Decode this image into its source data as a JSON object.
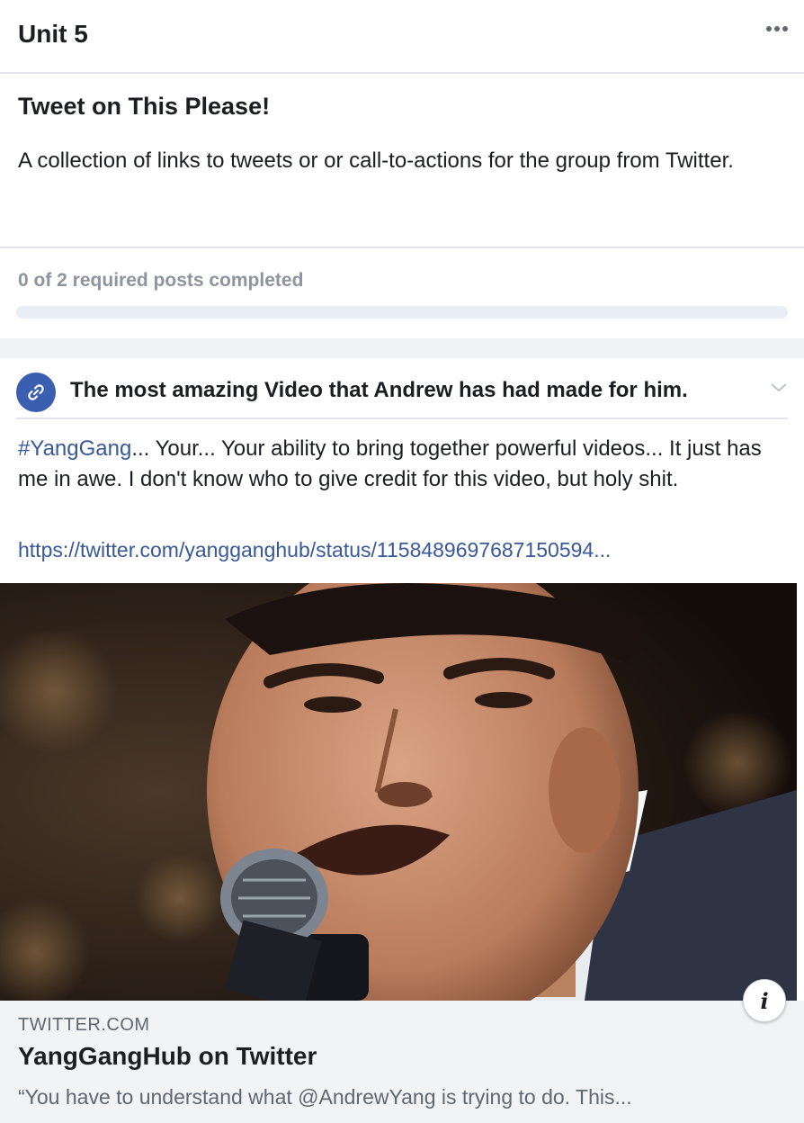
{
  "unit": {
    "title": "Unit 5"
  },
  "section": {
    "title": "Tweet on This Please!",
    "description": "A collection of links to tweets or or call-to-actions for the group from Twitter."
  },
  "progress": {
    "label": "0 of 2 required posts completed",
    "completed": 0,
    "required": 2
  },
  "post": {
    "title": "The most amazing Video that Andrew has had made for him.",
    "hashtag": "#YangGang",
    "body": "... Your... Your ability to bring together powerful videos... It just has me in awe. I don't know who to give credit for this video, but holy shit.",
    "url": "https://twitter.com/yangganghub/status/1158489697687150594..."
  },
  "link_preview": {
    "domain": "TWITTER.COM",
    "title": "YangGangHub on Twitter",
    "description": "“You have to understand what @AndrewYang is trying to do. This..."
  },
  "colors": {
    "link": "#385898",
    "badge": "#3a5fb0",
    "progress_track": "#e9edf5"
  },
  "icons": [
    "more-icon",
    "link-icon",
    "chevron-down-icon",
    "info-icon"
  ]
}
